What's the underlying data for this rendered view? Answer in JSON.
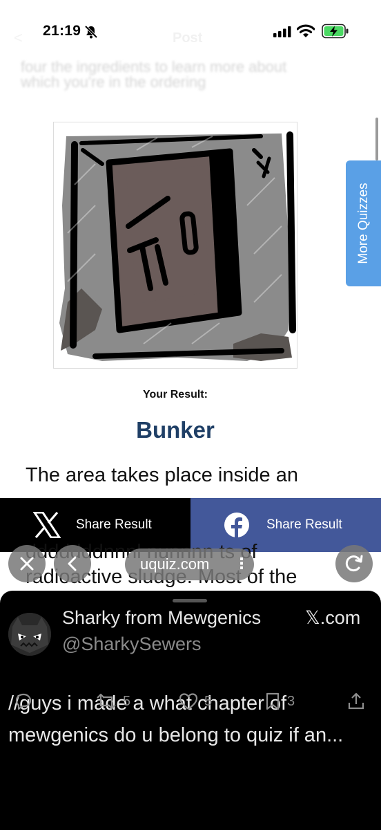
{
  "status_bar": {
    "time": "21:19",
    "nav_back": "<",
    "nav_title": "Post"
  },
  "ghost_text": "four the ingredients to learn more about which you're in the ordering",
  "more_quizzes": "More Quizzes",
  "result": {
    "label": "Your Result:",
    "title": "Bunker",
    "description_line1": "The area takes place inside an",
    "description_line2": "dddddddnnnl nunnnn ts of",
    "description_line3": "radioactive sludge. Most of the"
  },
  "share": {
    "x_label": "Share Result",
    "facebook_label": "Share Result"
  },
  "browser": {
    "url": "uquiz.com"
  },
  "post": {
    "display_name": "Sharky from Mewgenics",
    "source": "𝕏.com",
    "handle": "@SharkySewers",
    "text": "//guys i made a what chapter of mewgenics do u belong to quiz if an...",
    "retweets": "5",
    "likes": "5",
    "bookmarks": "3"
  },
  "colors": {
    "result_title": "#1f3f66",
    "more_quizzes_bg": "#5aa0e6",
    "facebook_bg": "#43589a",
    "x_bg": "#000000"
  }
}
